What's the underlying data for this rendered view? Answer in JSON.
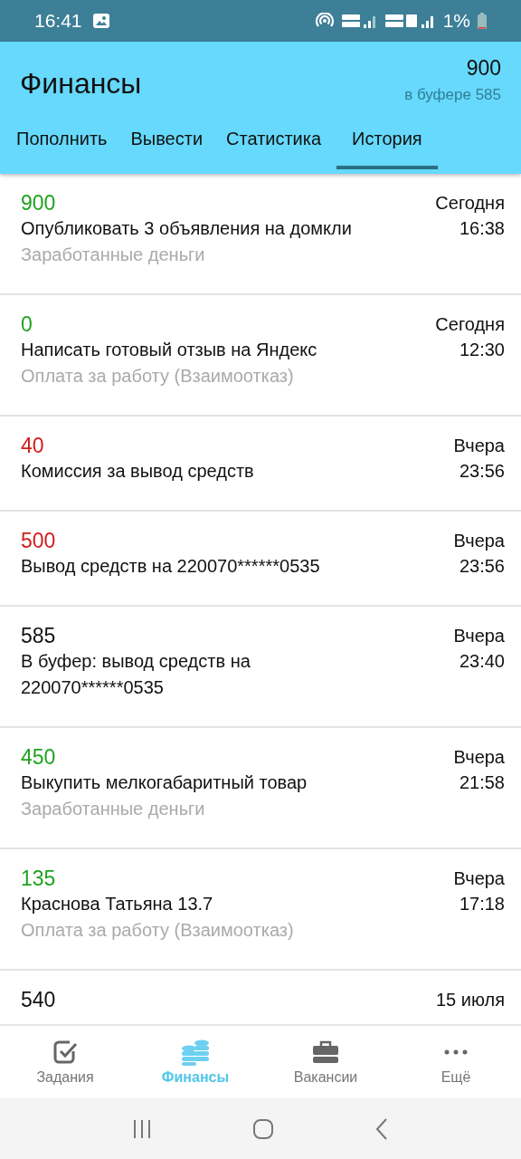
{
  "status_bar": {
    "time": "16:41",
    "battery": "1%"
  },
  "header": {
    "title": "Финансы",
    "balance": "900",
    "buffer": "в буфере 585"
  },
  "tabs": [
    {
      "label": "Пополнить",
      "selected": false
    },
    {
      "label": "Вывести",
      "selected": false
    },
    {
      "label": "Статистика",
      "selected": false
    },
    {
      "label": "История",
      "selected": true
    }
  ],
  "transactions": [
    {
      "amount": "900",
      "color": "#1fa21f",
      "title": "Опубликовать 3 объявления на домкли",
      "subtitle": "Заработанные деньги",
      "day": "Сегодня",
      "time": "16:38"
    },
    {
      "amount": "0",
      "color": "#1fa21f",
      "title": "Написать готовый отзыв на Яндекс",
      "subtitle": "Оплата за работу (Взаимоотказ)",
      "day": "Сегодня",
      "time": "12:30"
    },
    {
      "amount": "40",
      "color": "#d31b1b",
      "title": "Комиссия за вывод средств",
      "day": "Вчера",
      "time": "23:56"
    },
    {
      "amount": "500",
      "color": "#d31b1b",
      "title": "Вывод средств на 220070******0535",
      "day": "Вчера",
      "time": "23:56"
    },
    {
      "amount": "585",
      "color": "#111111",
      "title": "В буфер: вывод средств на 220070******0535",
      "day": "Вчера",
      "time": "23:40"
    },
    {
      "amount": "450",
      "color": "#1fa21f",
      "title": "Выкупить мелкогабаритный товар",
      "subtitle": "Заработанные деньги",
      "day": "Вчера",
      "time": "21:58"
    },
    {
      "amount": "135",
      "color": "#1fa21f",
      "title": "Краснова Татьяна 13.7",
      "subtitle": "Оплата за работу (Взаимоотказ)",
      "day": "Вчера",
      "time": "17:18"
    },
    {
      "amount": "540",
      "color": "#111111",
      "day": "15 июля"
    }
  ],
  "bottom_nav": [
    {
      "label": "Задания",
      "kind": "tasks",
      "selected": false
    },
    {
      "label": "Финансы",
      "kind": "coins",
      "selected": true
    },
    {
      "label": "Вакансии",
      "kind": "briefcase",
      "selected": false
    },
    {
      "label": "Ещё",
      "kind": "more",
      "selected": false
    }
  ]
}
